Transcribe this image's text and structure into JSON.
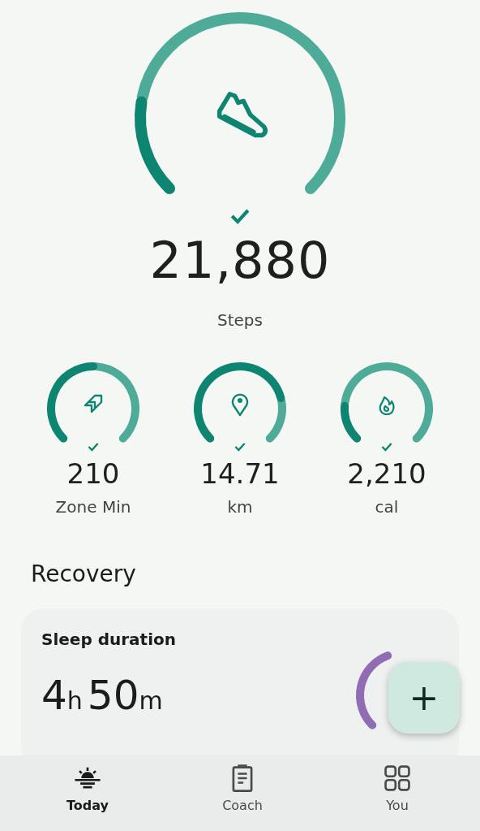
{
  "steps": {
    "goal_met": true,
    "value": "21,880",
    "label": "Steps"
  },
  "metrics": [
    {
      "goal_met": true,
      "value": "210",
      "label": "Zone Min"
    },
    {
      "goal_met": true,
      "value": "14.71",
      "label": "km"
    },
    {
      "goal_met": true,
      "value": "2,210",
      "label": "cal"
    }
  ],
  "recovery": {
    "heading": "Recovery",
    "card": {
      "title": "Sleep duration",
      "duration": [
        {
          "number": "4",
          "unit": "h"
        },
        {
          "number": "50",
          "unit": "m"
        }
      ]
    }
  },
  "fab": {
    "label": "+"
  },
  "nav": [
    {
      "label": "Today",
      "selected": true
    },
    {
      "label": "Coach",
      "selected": false
    },
    {
      "label": "You",
      "selected": false
    }
  ]
}
